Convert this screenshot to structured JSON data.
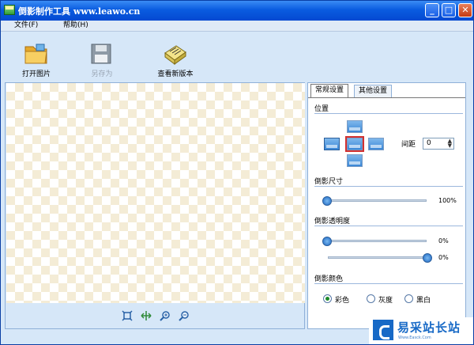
{
  "window": {
    "title": "倒影制作工具 www.leawo.cn",
    "controls": {
      "minimize": "_",
      "maximize": "□",
      "close": "✕"
    }
  },
  "menu": [
    {
      "label": "文件(F)"
    },
    {
      "label": "帮助(H)"
    }
  ],
  "toolbar": {
    "open_label": "打开图片",
    "saveas_label": "另存为",
    "update_label": "查看新版本"
  },
  "tabs": {
    "general": "常规设置",
    "other": "其他设置"
  },
  "position": {
    "title": "位置",
    "spacing_label": "间距",
    "spacing_value": "0",
    "selected": "left"
  },
  "size": {
    "title": "倒影尺寸",
    "value_label": "100%",
    "value": 100
  },
  "opacity": {
    "title": "倒影透明度",
    "start_label": "0%",
    "start_value": 0,
    "end_label": "0%",
    "end_value": 100
  },
  "color": {
    "title": "倒影颜色",
    "options": [
      "彩色",
      "灰度",
      "黑白"
    ],
    "selected": "彩色"
  },
  "watermark": {
    "text": "易采站长站",
    "sub": "Www.Easck.Com"
  },
  "colors": {
    "titlebar": "#0a5ce0",
    "panel_bg": "#d6e7f8",
    "checker": "#f4ecd6",
    "accent": "#1769c6"
  }
}
